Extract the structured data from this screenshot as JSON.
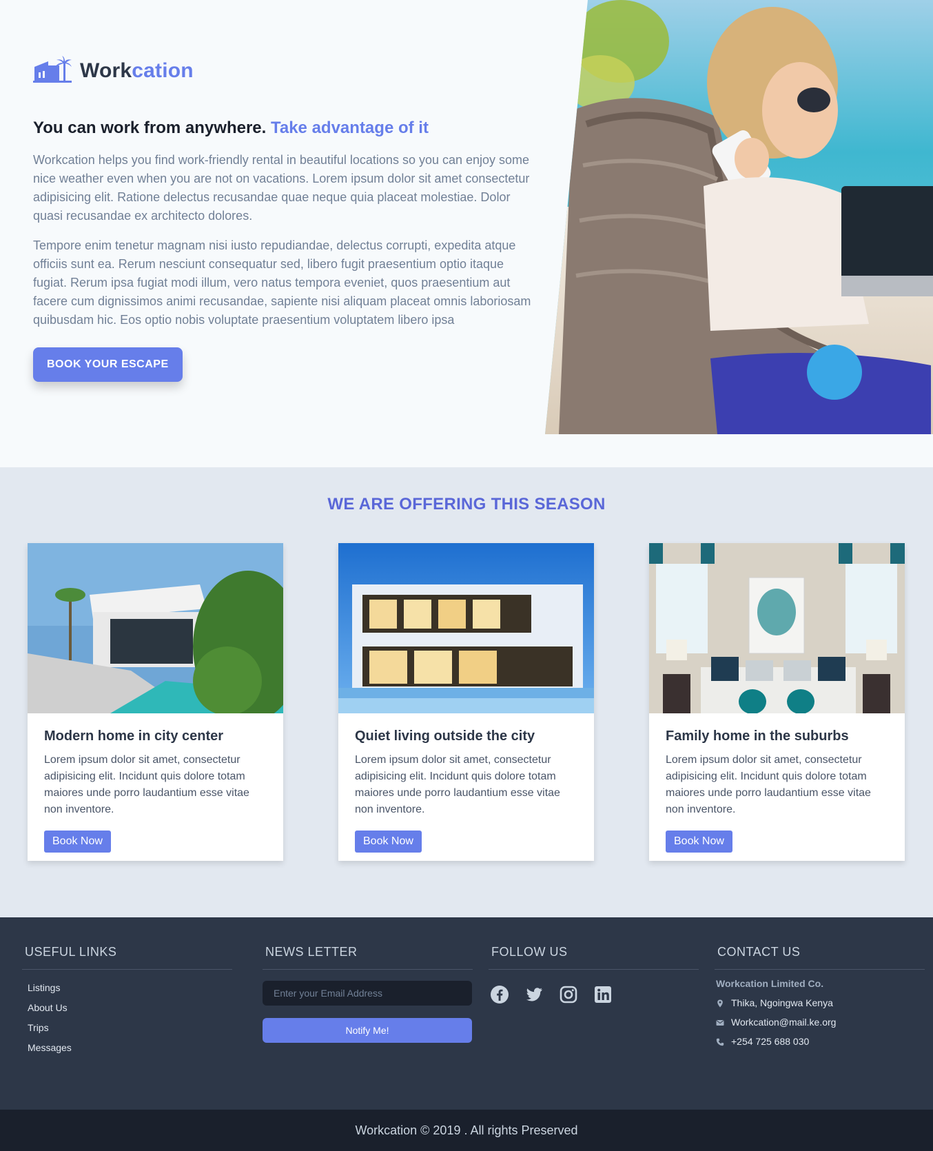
{
  "brand": {
    "name_part1": "Work",
    "name_part2": "cation",
    "accent_color": "#667eea"
  },
  "hero": {
    "headline": "You can work from anywhere.",
    "headline_accent": "Take advantage of it",
    "paragraph1": "Workcation helps you find work-friendly rental in beautiful locations so you can enjoy some nice weather even when you are not on vacations. Lorem ipsum dolor sit amet consectetur adipisicing elit. Ratione delectus recusandae quae neque quia placeat molestiae. Dolor quasi recusandae ex architecto dolores.",
    "paragraph2": "Tempore enim tenetur magnam nisi iusto repudiandae, delectus corrupti, expedita atque officiis sunt ea. Rerum nesciunt consequatur sed, libero fugit praesentium optio itaque fugiat. Rerum ipsa fugiat modi illum, vero natus tempora eveniet, quos praesentium aut facere cum dignissimos animi recusandae, sapiente nisi aliquam placeat omnis laboriosam quibusdam hic. Eos optio nobis voluptate praesentium voluptatem libero ipsa",
    "cta_label": "BOOK YOUR ESCAPE"
  },
  "offers": {
    "title": "WE ARE OFFERING THIS SEASON",
    "cards": [
      {
        "title": "Modern home in city center",
        "text": "Lorem ipsum dolor sit amet, consectetur adipisicing elit. Incidunt quis dolore totam maiores unde porro laudantium esse vitae non inventore.",
        "button": "Book Now"
      },
      {
        "title": "Quiet living outside the city",
        "text": "Lorem ipsum dolor sit amet, consectetur adipisicing elit. Incidunt quis dolore totam maiores unde porro laudantium esse vitae non inventore.",
        "button": "Book Now"
      },
      {
        "title": "Family home in the suburbs",
        "text": "Lorem ipsum dolor sit amet, consectetur adipisicing elit. Incidunt quis dolore totam maiores unde porro laudantium esse vitae non inventore.",
        "button": "Book Now"
      }
    ]
  },
  "footer": {
    "useful_links": {
      "heading": "USEFUL LINKS",
      "items": [
        "Listings",
        "About Us",
        "Trips",
        "Messages"
      ]
    },
    "newsletter": {
      "heading": "NEWS LETTER",
      "placeholder": "Enter your Email Address",
      "button": "Notify Me!"
    },
    "follow": {
      "heading": "FOLLOW US",
      "icons": [
        "facebook-icon",
        "twitter-icon",
        "instagram-icon",
        "linkedin-icon"
      ]
    },
    "contact": {
      "heading": "CONTACT US",
      "company": "Workcation Limited Co.",
      "address": "Thika, Ngoingwa Kenya",
      "email": "Workcation@mail.ke.org",
      "phone": "+254 725 688 030"
    }
  },
  "copyright": "Workcation © 2019 . All rights Preserved"
}
